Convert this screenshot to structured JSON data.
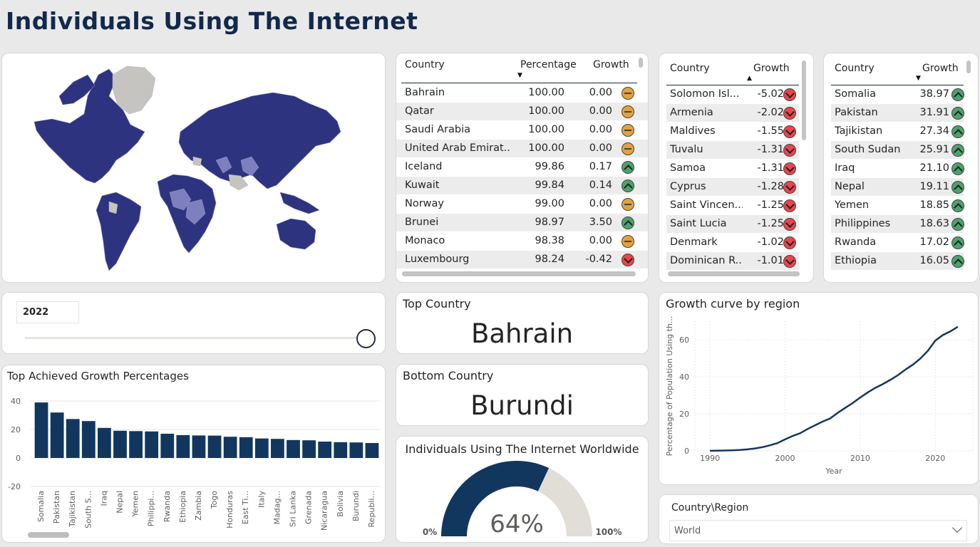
{
  "title": "Individuals Using The Internet",
  "colors": {
    "navy": "#13294b",
    "bar": "#12375f",
    "map_fill": "#2e3380",
    "map_nodata": "#c6c4c1"
  },
  "table_top": {
    "headers": {
      "country": "Country",
      "percentage": "Percentage",
      "growth": "Growth"
    },
    "rows": [
      {
        "country": "Bahrain",
        "percentage": "100.00",
        "growth": "0.00",
        "trend": "flat"
      },
      {
        "country": "Qatar",
        "percentage": "100.00",
        "growth": "0.00",
        "trend": "flat"
      },
      {
        "country": "Saudi Arabia",
        "percentage": "100.00",
        "growth": "0.00",
        "trend": "flat"
      },
      {
        "country": "United Arab Emirat...",
        "percentage": "100.00",
        "growth": "0.00",
        "trend": "flat"
      },
      {
        "country": "Iceland",
        "percentage": "99.86",
        "growth": "0.17",
        "trend": "up"
      },
      {
        "country": "Kuwait",
        "percentage": "99.84",
        "growth": "0.14",
        "trend": "up"
      },
      {
        "country": "Norway",
        "percentage": "99.00",
        "growth": "0.00",
        "trend": "flat"
      },
      {
        "country": "Brunei",
        "percentage": "98.97",
        "growth": "3.50",
        "trend": "up"
      },
      {
        "country": "Monaco",
        "percentage": "98.38",
        "growth": "0.00",
        "trend": "flat"
      },
      {
        "country": "Luxembourg",
        "percentage": "98.24",
        "growth": "-0.42",
        "trend": "down"
      }
    ]
  },
  "table_neg": {
    "headers": {
      "country": "Country",
      "growth": "Growth"
    },
    "rows": [
      {
        "country": "Solomon Isl...",
        "growth": "-5.02"
      },
      {
        "country": "Armenia",
        "growth": "-2.02"
      },
      {
        "country": "Maldives",
        "growth": "-1.55"
      },
      {
        "country": "Tuvalu",
        "growth": "-1.31"
      },
      {
        "country": "Samoa",
        "growth": "-1.31"
      },
      {
        "country": "Cyprus",
        "growth": "-1.28"
      },
      {
        "country": "Saint Vincen...",
        "growth": "-1.25"
      },
      {
        "country": "Saint Lucia",
        "growth": "-1.25"
      },
      {
        "country": "Denmark",
        "growth": "-1.02"
      },
      {
        "country": "Dominican R...",
        "growth": "-1.01"
      }
    ]
  },
  "table_pos": {
    "headers": {
      "country": "Country",
      "growth": "Growth"
    },
    "rows": [
      {
        "country": "Somalia",
        "growth": "38.97"
      },
      {
        "country": "Pakistan",
        "growth": "31.91"
      },
      {
        "country": "Tajikistan",
        "growth": "27.34"
      },
      {
        "country": "South Sudan",
        "growth": "25.91"
      },
      {
        "country": "Iraq",
        "growth": "21.10"
      },
      {
        "country": "Nepal",
        "growth": "19.11"
      },
      {
        "country": "Yemen",
        "growth": "18.85"
      },
      {
        "country": "Philippines",
        "growth": "18.63"
      },
      {
        "country": "Rwanda",
        "growth": "17.02"
      },
      {
        "country": "Ethiopia",
        "growth": "16.05"
      }
    ]
  },
  "year_slicer": {
    "value": "2022",
    "position": 1.0
  },
  "top_country": {
    "label": "Top Country",
    "value": "Bahrain"
  },
  "bottom_country": {
    "label": "Bottom Country",
    "value": "Burundi"
  },
  "gauge": {
    "title": "Individuals Using The Internet Worldwide",
    "value": 64,
    "value_label": "64%",
    "min_label": "0%",
    "max_label": "100%"
  },
  "region_slicer": {
    "label": "Country\\Region",
    "value": "World"
  },
  "chart_data": [
    {
      "type": "bar",
      "title": "Top Achieved Growth Percentages",
      "categories": [
        "Somalia",
        "Pakistan",
        "Tajikistan",
        "South S...",
        "Iraq",
        "Nepal",
        "Yemen",
        "Philippi...",
        "Rwanda",
        "Ethiopia",
        "Zambia",
        "Togo",
        "Honduras",
        "East Ti...",
        "Italy",
        "Madag...",
        "Sri Lanka",
        "Grenada",
        "Nicaragua",
        "Bolivia",
        "Burundi",
        "Republi..."
      ],
      "values": [
        38.97,
        31.91,
        27.34,
        25.91,
        21.1,
        19.11,
        18.85,
        18.63,
        17.02,
        16.05,
        15.8,
        15.7,
        14.9,
        14.6,
        13.7,
        13.4,
        12.6,
        12.4,
        11.5,
        11.1,
        10.9,
        10.5
      ],
      "ylim": [
        -20,
        45
      ],
      "yticks": [
        "40",
        "20",
        "0",
        "-20"
      ]
    },
    {
      "type": "line",
      "title": "Growth curve by region",
      "xlabel": "Year",
      "ylabel": "Percentage of Population Using th...",
      "xlim": [
        1988,
        2025
      ],
      "ylim": [
        0,
        70
      ],
      "xticks": [
        "1990",
        "2000",
        "2010",
        "2020"
      ],
      "yticks": [
        "0",
        "20",
        "40",
        "60"
      ],
      "x": [
        1990,
        1991,
        1992,
        1993,
        1994,
        1995,
        1996,
        1997,
        1998,
        1999,
        2000,
        2001,
        2002,
        2003,
        2004,
        2005,
        2006,
        2007,
        2008,
        2009,
        2010,
        2011,
        2012,
        2013,
        2014,
        2015,
        2016,
        2017,
        2018,
        2019,
        2020,
        2021,
        2022,
        2023
      ],
      "y": [
        0.05,
        0.1,
        0.2,
        0.3,
        0.5,
        0.8,
        1.3,
        2.0,
        3.0,
        4.2,
        6.2,
        8.0,
        9.5,
        11.8,
        13.8,
        15.8,
        17.5,
        20.5,
        23.2,
        25.8,
        28.8,
        31.5,
        34.0,
        36.0,
        38.3,
        40.8,
        43.8,
        46.5,
        49.8,
        54.0,
        59.5,
        62.5,
        64.5,
        67.0
      ]
    }
  ]
}
